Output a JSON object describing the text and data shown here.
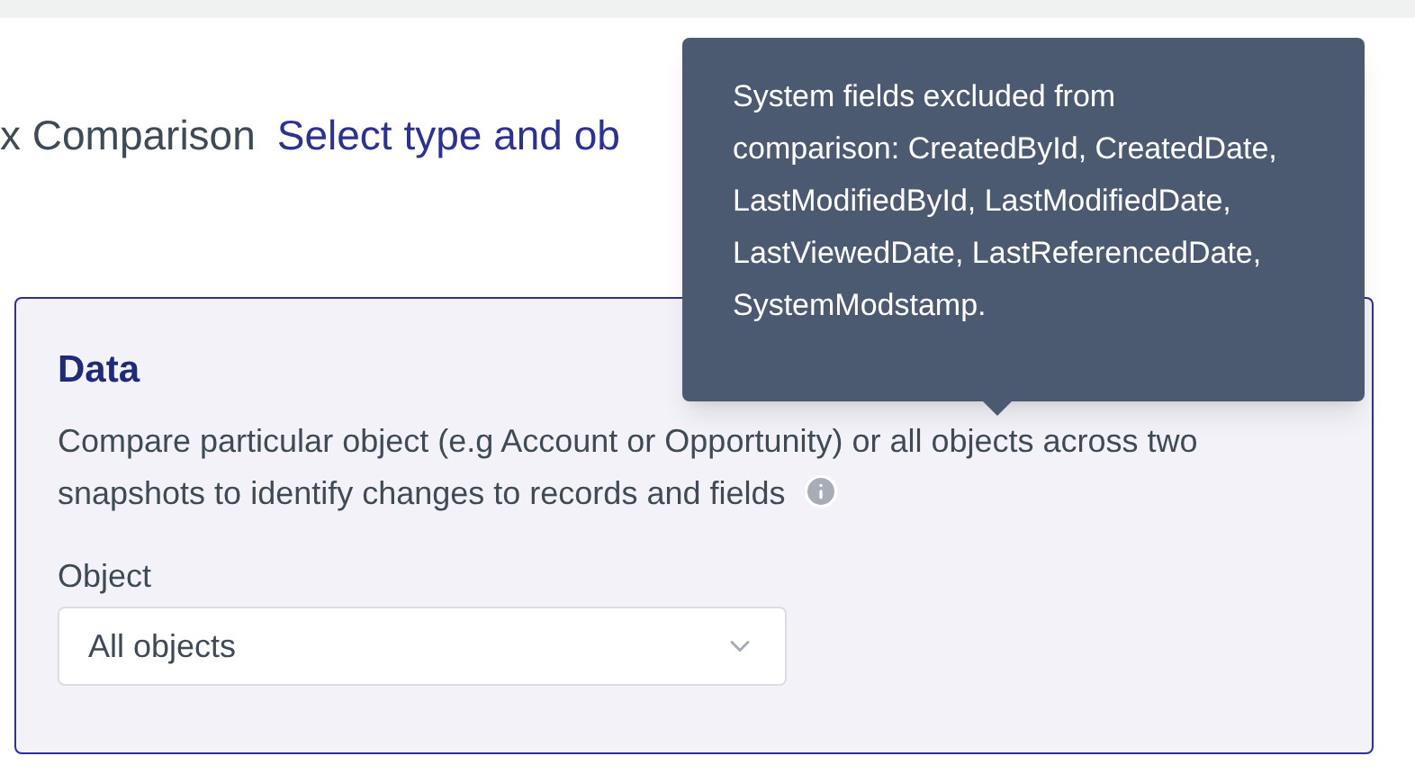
{
  "header": {
    "title": "x Comparison",
    "subtitle": "Select type and ob"
  },
  "tooltip": {
    "text": "System fields excluded from comparison: CreatedById, CreatedDate, LastModifiedById, LastModifiedDate, LastViewedDate, LastReferencedDate, SystemModstamp."
  },
  "card": {
    "title": "Data",
    "description": "Compare particular object (e.g Account or Opportunity) or all objects across two snapshots to identify changes to records and fields",
    "field": {
      "label": "Object",
      "value": "All objects"
    }
  }
}
